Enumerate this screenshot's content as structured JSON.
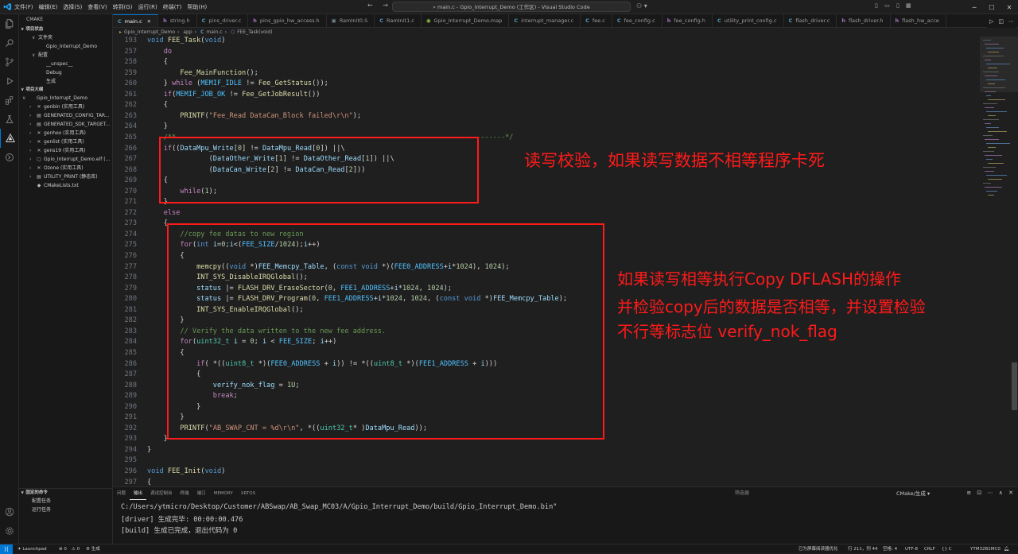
{
  "window": {
    "menu": [
      "文件(F)",
      "编辑(E)",
      "选择(S)",
      "查看(V)",
      "转到(G)",
      "运行(R)",
      "终端(T)",
      "帮助(H)"
    ],
    "search_text": "main.c - Gpio_Interrupt_Demo (工作区) - Visual Studio Code",
    "nav_back": "←",
    "nav_forward": "→"
  },
  "sidebar": {
    "header": "CMAKE",
    "project_status_title": "项目状态",
    "status_items": [
      {
        "label": "文件夹",
        "indent": 1
      },
      {
        "label": "Gpio_Interrupt_Demo",
        "indent": 2
      },
      {
        "label": "配置",
        "indent": 1
      },
      {
        "label": "__unspec__",
        "indent": 2
      },
      {
        "label": "Debug",
        "indent": 2
      },
      {
        "label": "生成",
        "indent": 2
      }
    ],
    "outline_title": "项目大纲",
    "outline_items": [
      {
        "label": "Gpio_Interrupt_Demo",
        "icon": "",
        "caret": "∨",
        "indent": 0
      },
      {
        "label": "genbin (实用工具)",
        "icon": "✕",
        "caret": "›",
        "indent": 1
      },
      {
        "label": "GENERATED_CONFIG_TAR...",
        "icon": "▤",
        "caret": "›",
        "indent": 1
      },
      {
        "label": "GENERATED_SDK_TARGET...",
        "icon": "▤",
        "caret": "›",
        "indent": 1
      },
      {
        "label": "genhex (实用工具)",
        "icon": "✕",
        "caret": "›",
        "indent": 1
      },
      {
        "label": "genlist (实用工具)",
        "icon": "✕",
        "caret": "›",
        "indent": 1
      },
      {
        "label": "gens19 (实用工具)",
        "icon": "✕",
        "caret": "›",
        "indent": 1
      },
      {
        "label": "Gpio_Interrupt_Demo.elf (...",
        "icon": "▢",
        "caret": "›",
        "indent": 1
      },
      {
        "label": "Ozone (实用工具)",
        "icon": "✕",
        "caret": "›",
        "indent": 1
      },
      {
        "label": "UTILITY_PRINT (静态库)",
        "icon": "▤",
        "caret": "›",
        "indent": 1
      },
      {
        "label": "CMakeLists.txt",
        "icon": "◆",
        "caret": "",
        "indent": 1
      }
    ],
    "pinned_title": "固定的命令",
    "pinned_items": [
      "配置任务",
      "运行任务"
    ]
  },
  "tabs": [
    {
      "label": "main.c",
      "icon": "C",
      "color": "#519aba",
      "active": true
    },
    {
      "label": "string.h",
      "icon": "h",
      "color": "#a074c4",
      "active": false
    },
    {
      "label": "pins_driver.c",
      "icon": "C",
      "color": "#519aba",
      "active": false
    },
    {
      "label": "pins_gpio_hw_access.h",
      "icon": "h",
      "color": "#a074c4",
      "active": false
    },
    {
      "label": "RamInit0.S",
      "icon": "▣",
      "color": "#6d8086",
      "active": false
    },
    {
      "label": "RamInit1.c",
      "icon": "C",
      "color": "#519aba",
      "active": false
    },
    {
      "label": "Gpio_Interrupt_Demo.map",
      "icon": "◉",
      "color": "#8dc149",
      "active": false
    },
    {
      "label": "interrupt_manager.c",
      "icon": "C",
      "color": "#519aba",
      "active": false
    },
    {
      "label": "fee.c",
      "icon": "C",
      "color": "#519aba",
      "active": false
    },
    {
      "label": "fee_config.c",
      "icon": "C",
      "color": "#519aba",
      "active": false
    },
    {
      "label": "fee_config.h",
      "icon": "h",
      "color": "#a074c4",
      "active": false
    },
    {
      "label": "utility_print_config.c",
      "icon": "C",
      "color": "#519aba",
      "active": false
    },
    {
      "label": "flash_driver.c",
      "icon": "C",
      "color": "#519aba",
      "active": false
    },
    {
      "label": "flash_driver.h",
      "icon": "h",
      "color": "#a074c4",
      "active": false
    },
    {
      "label": "flash_hw_acce",
      "icon": "h",
      "color": "#a074c4",
      "active": false
    }
  ],
  "breadcrumb": [
    "Gpio_Interrupt_Demo",
    "app",
    "main.c",
    "FEE_Task(void)"
  ],
  "editor": {
    "lines": [
      {
        "n": "193",
        "t": "void FEE_Task(void)"
      },
      {
        "n": "257",
        "t": "    do"
      },
      {
        "n": "258",
        "t": "    {"
      },
      {
        "n": "259",
        "t": "        Fee_MainFunction();"
      },
      {
        "n": "260",
        "t": "    } while (MEMIF_IDLE != Fee_GetStatus());"
      },
      {
        "n": "261",
        "t": "    if(MEMIF_JOB_OK != Fee_GetJobResult())"
      },
      {
        "n": "262",
        "t": "    {"
      },
      {
        "n": "263",
        "t": "        PRINTF(\"Fee_Read DataCan_Block failed\\r\\n\");"
      },
      {
        "n": "264",
        "t": "    }"
      },
      {
        "n": "265",
        "t": "    /**--------------------------------------------------------------------------------*/"
      },
      {
        "n": "266",
        "t": "    if((DataMpu_Write[0] != DataMpu_Read[0]) ||\\"
      },
      {
        "n": "267",
        "t": "               (DataOther_Write[1] != DataOther_Read[1]) ||\\"
      },
      {
        "n": "268",
        "t": "               (DataCan_Write[2] != DataCan_Read[2]))"
      },
      {
        "n": "269",
        "t": "    {"
      },
      {
        "n": "270",
        "t": "        while(1);"
      },
      {
        "n": "271",
        "t": "    }"
      },
      {
        "n": "272",
        "t": "    else"
      },
      {
        "n": "273",
        "t": "    {"
      },
      {
        "n": "274",
        "t": "        //copy fee datas to new region"
      },
      {
        "n": "275",
        "t": "        for(int i=0;i<(FEE_SIZE/1024);i++)"
      },
      {
        "n": "276",
        "t": "        {"
      },
      {
        "n": "277",
        "t": "            memcpy((void *)FEE_Memcpy_Table, (const void *)(FEE0_ADDRESS+i*1024), 1024);"
      },
      {
        "n": "278",
        "t": "            INT_SYS_DisableIRQGlobal();"
      },
      {
        "n": "279",
        "t": "            status |= FLASH_DRV_EraseSector(0, FEE1_ADDRESS+i*1024, 1024);"
      },
      {
        "n": "280",
        "t": "            status |= FLASH_DRV_Program(0, FEE1_ADDRESS+i*1024, 1024, (const void *)FEE_Memcpy_Table);"
      },
      {
        "n": "281",
        "t": "            INT_SYS_EnableIRQGlobal();"
      },
      {
        "n": "282",
        "t": "        }"
      },
      {
        "n": "283",
        "t": "        // Verify the data written to the new fee address."
      },
      {
        "n": "284",
        "t": "        for(uint32_t i = 0; i < FEE_SIZE; i++)"
      },
      {
        "n": "285",
        "t": "        {"
      },
      {
        "n": "286",
        "t": "            if( *((uint8_t *)(FEE0_ADDRESS + i)) != *((uint8_t *)(FEE1_ADDRESS + i)))"
      },
      {
        "n": "287",
        "t": "            {"
      },
      {
        "n": "288",
        "t": "                verify_nok_flag = 1U;"
      },
      {
        "n": "289",
        "t": "                break;"
      },
      {
        "n": "290",
        "t": "            }"
      },
      {
        "n": "291",
        "t": "        }"
      },
      {
        "n": "292",
        "t": "        PRINTF(\"AB_SWAP_CNT = %d\\r\\n\", *((uint32_t* )DataMpu_Read));"
      },
      {
        "n": "293",
        "t": "    }"
      },
      {
        "n": "294",
        "t": "}"
      },
      {
        "n": "295",
        "t": ""
      },
      {
        "n": "296",
        "t": "void FEE_Init(void)"
      },
      {
        "n": "297",
        "t": "{"
      },
      {
        "n": "298",
        "t": "    Fee_Init(&FEEFeeConfig);"
      }
    ]
  },
  "annotations": {
    "note1": "读写校验，如果读写数据不相等程序卡死",
    "note2_lines": [
      "如果读写相等执行Copy DFLASH的操作",
      "并检验copy后的数据是否相等，并设置检验",
      "不行等标志位 verify_nok_flag"
    ],
    "color": "#ff1a1a"
  },
  "panel": {
    "tabs": [
      "问题",
      "输出",
      "调试控制台",
      "终端",
      "端口",
      "MEMORY",
      "XRTOS"
    ],
    "active_tab": "输出",
    "filter_placeholder": "筛选器",
    "channel": "CMake/生成",
    "output_lines": [
      "C:/Users/ytmicro/Desktop/Customer/ABSwap/AB_Swap_MC03/A/Gpio_Interrupt_Demo/build/Gpio_Interrupt_Demo.bin\"",
      "[driver] 生成完毕: 00:00:00.476",
      "[build] 生成已完成，退出代码为 0"
    ]
  },
  "statusbar": {
    "remote": "⟩⟨",
    "launchpad": "Launchpad",
    "errors": "⊗ 0",
    "warnings": "⚠ 0",
    "build": "生成",
    "screen_reader": "已为屏幕阅读器优化",
    "position": "行 211，列 44",
    "spaces": "空格: 4",
    "encoding": "UTF-8",
    "eol": "CRLF",
    "language": "{} C",
    "device": "YTM32B1MC0"
  }
}
